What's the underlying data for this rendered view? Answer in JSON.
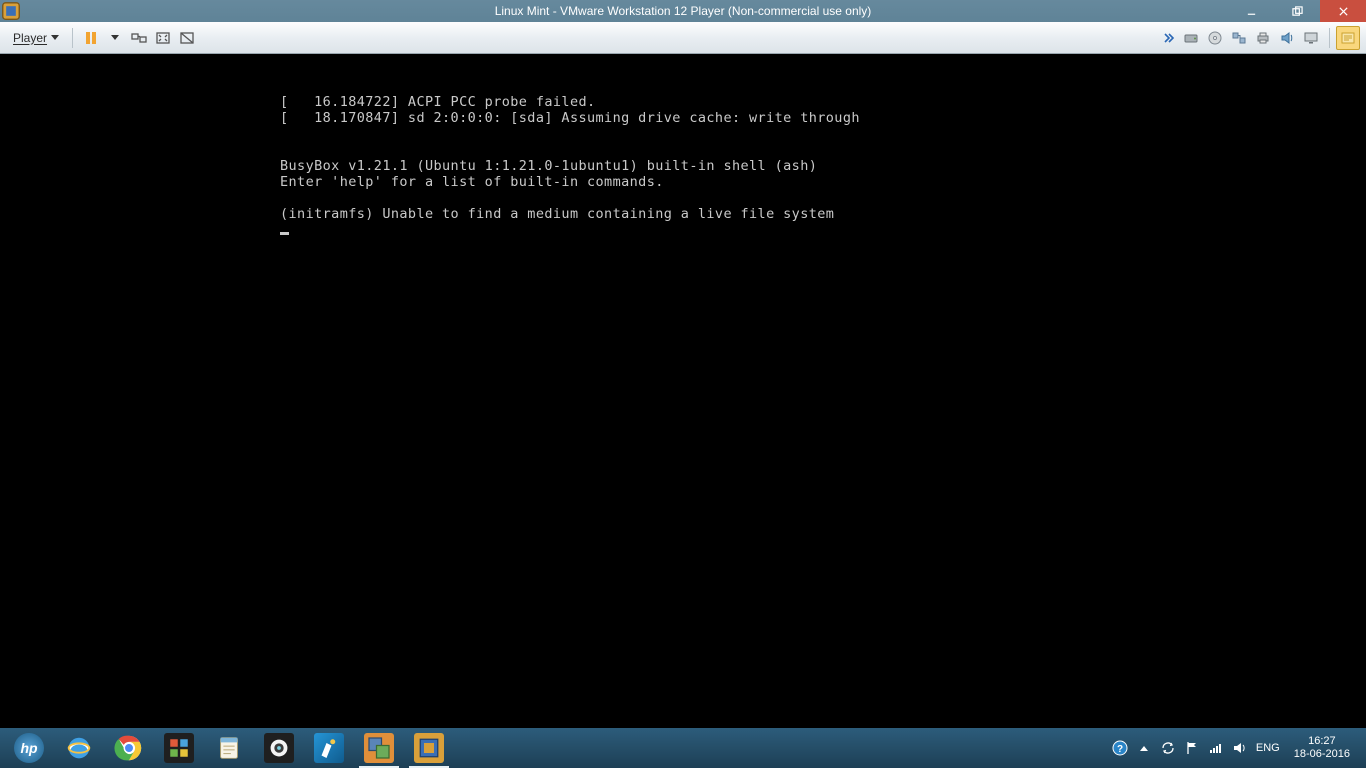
{
  "window": {
    "title": "Linux Mint - VMware Workstation 12 Player (Non-commercial use only)"
  },
  "toolbar": {
    "player_label": "Player"
  },
  "console": {
    "lines": [
      "[   16.184722] ACPI PCC probe failed.",
      "[   18.170847] sd 2:0:0:0: [sda] Assuming drive cache: write through",
      "",
      "",
      "BusyBox v1.21.1 (Ubuntu 1:1.21.0-1ubuntu1) built-in shell (ash)",
      "Enter 'help' for a list of built-in commands.",
      "",
      "(initramfs) Unable to find a medium containing a live file system"
    ]
  },
  "tray": {
    "lang": "ENG",
    "time": "16:27",
    "date": "18-06-2016"
  }
}
